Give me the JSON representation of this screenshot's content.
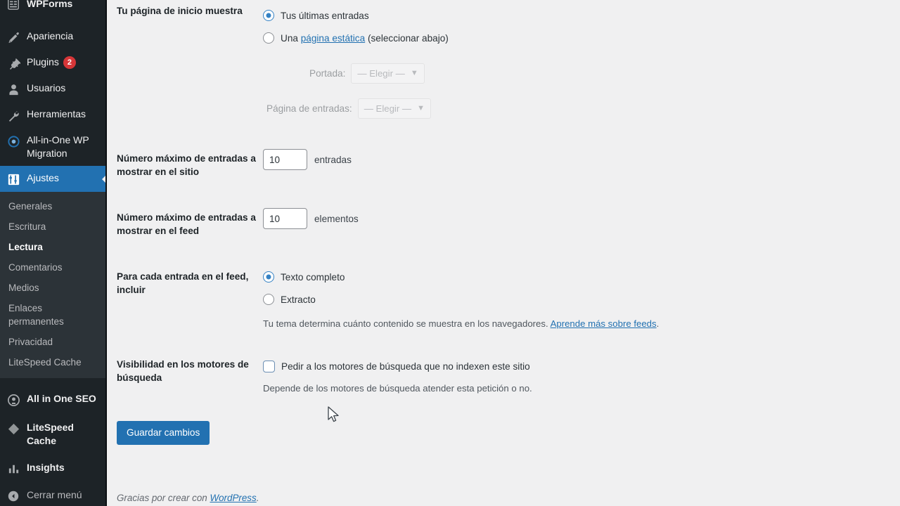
{
  "sidebar": {
    "items": [
      {
        "label": "WPForms",
        "icon": "wpforms-icon",
        "partial": true,
        "badge": null,
        "current": false
      },
      {
        "label": "Apariencia",
        "icon": "paintbrush-icon",
        "partial": false,
        "badge": null,
        "current": false
      },
      {
        "label": "Plugins",
        "icon": "plug-icon",
        "partial": false,
        "badge": "2",
        "current": false
      },
      {
        "label": "Usuarios",
        "icon": "user-icon",
        "partial": false,
        "badge": null,
        "current": false
      },
      {
        "label": "Herramientas",
        "icon": "wrench-icon",
        "partial": false,
        "badge": null,
        "current": false
      },
      {
        "label": "All-in-One WP Migration",
        "icon": "migration-icon",
        "partial": false,
        "badge": null,
        "current": false
      },
      {
        "label": "Ajustes",
        "icon": "settings-icon",
        "partial": false,
        "badge": null,
        "current": true
      }
    ],
    "submenu": [
      {
        "label": "Generales",
        "current": false
      },
      {
        "label": "Escritura",
        "current": false
      },
      {
        "label": "Lectura",
        "current": true
      },
      {
        "label": "Comentarios",
        "current": false
      },
      {
        "label": "Medios",
        "current": false
      },
      {
        "label": "Enlaces permanentes",
        "current": false
      },
      {
        "label": "Privacidad",
        "current": false
      },
      {
        "label": "LiteSpeed Cache",
        "current": false
      }
    ],
    "plugin_items": [
      {
        "label": "All in One SEO",
        "icon": "aioseo-icon"
      },
      {
        "label": "LiteSpeed Cache",
        "icon": "litespeed-icon"
      },
      {
        "label": "Insights",
        "icon": "insights-icon"
      }
    ],
    "collapse": {
      "label": "Cerrar menú",
      "icon": "collapse-arrow-icon"
    },
    "colors": {
      "menu_bg": "#1d2327",
      "submenu_bg": "#2c3338",
      "current_bg": "#2271b1",
      "badge_bg": "#d63638"
    }
  },
  "main": {
    "homepage_section": {
      "label": "Tu página de inicio muestra",
      "option_latest": "Tus últimas entradas",
      "option_static_prefix": "Una ",
      "option_static_link": "página estática",
      "option_static_suffix": " (seleccionar abajo)",
      "selected": "latest",
      "front_page_label": "Portada:",
      "front_page_value": "— Elegir —",
      "posts_page_label": "Página de entradas:",
      "posts_page_value": "— Elegir —"
    },
    "posts_per_page": {
      "label": "Número máximo de entradas a mostrar en el sitio",
      "value": "10",
      "unit": "entradas"
    },
    "posts_per_rss": {
      "label": "Número máximo de entradas a mostrar en el feed",
      "value": "10",
      "unit": "elementos"
    },
    "feed_content": {
      "label": "Para cada entrada en el feed, incluir",
      "option_full": "Texto completo",
      "option_excerpt": "Extracto",
      "selected": "full",
      "help_prefix": "Tu tema determina cuánto contenido se muestra en los navegadores. ",
      "help_link": "Aprende más sobre feeds",
      "help_suffix": "."
    },
    "search_visibility": {
      "label": "Visibilidad en los motores de búsqueda",
      "checkbox_label": "Pedir a los motores de búsqueda que no indexen este sitio",
      "checked": false,
      "help": "Depende de los motores de búsqueda atender esta petición o no."
    },
    "submit": {
      "label": "Guardar cambios"
    }
  },
  "footer": {
    "prefix": "Gracias por crear con ",
    "link": "WordPress",
    "suffix": "."
  }
}
